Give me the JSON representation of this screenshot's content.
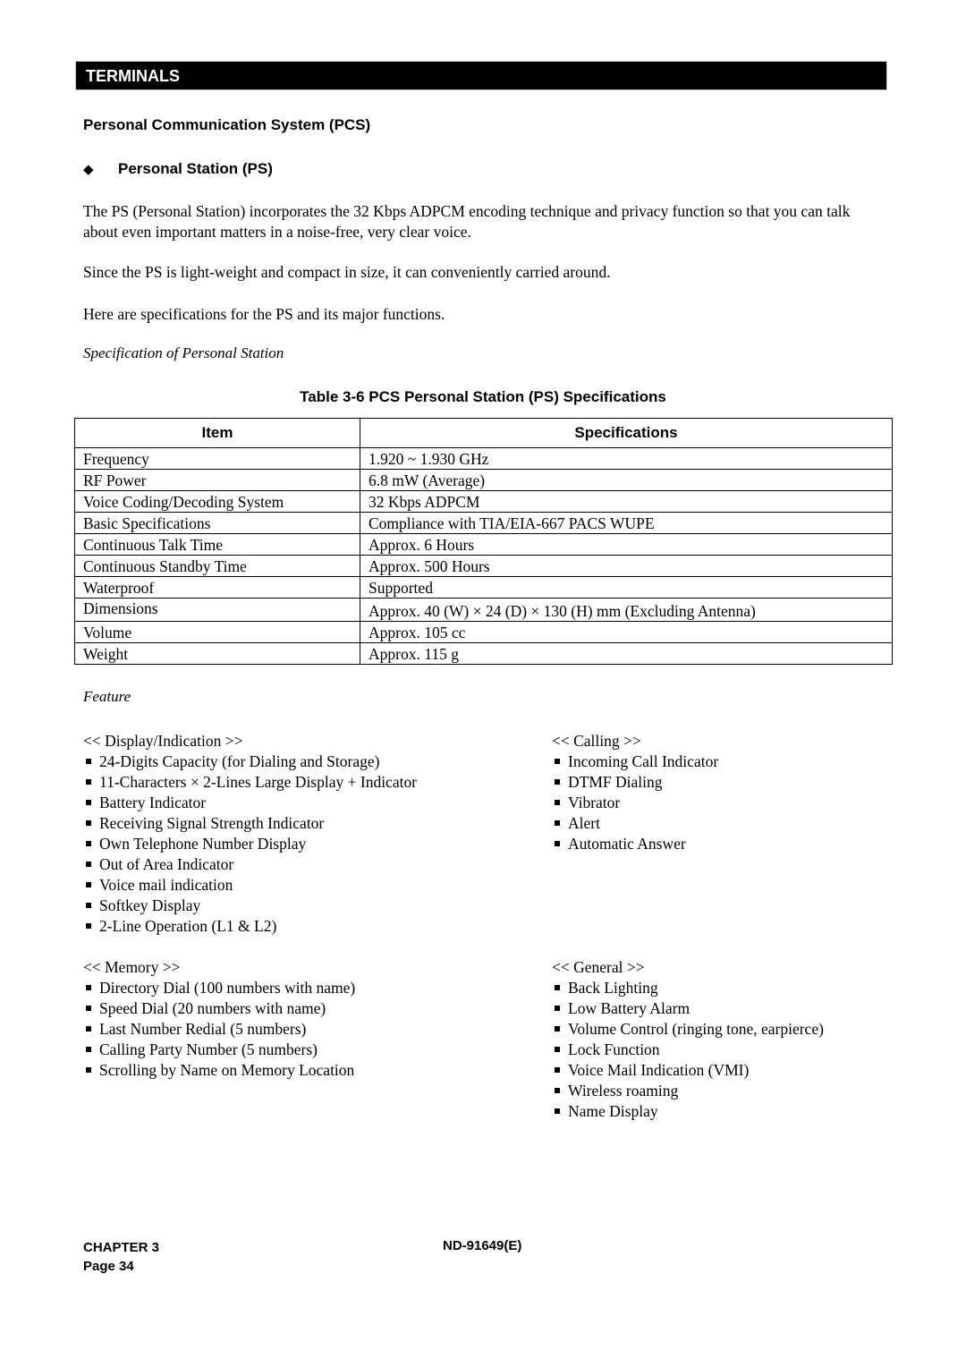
{
  "section_bar": {
    "label": "TERMINALS"
  },
  "heading": "Personal Communication System (PCS)",
  "subheading": {
    "icon": "diamond-bullet-icon",
    "label": "Personal Station (PS)"
  },
  "paragraphs": [
    "The PS (Personal Station) incorporates the 32 Kbps ADPCM encoding technique and privacy function so that you can talk about even important matters in a noise-free, very clear voice.",
    "Since the PS is light-weight and compact in size, it can conveniently carried around.",
    "Here are specifications for the PS and its major functions."
  ],
  "spec_caption": "Specification of Personal Station",
  "table": {
    "title": "Table 3-6  PCS Personal Station (PS) Specifications",
    "headers": [
      "Item",
      "Specifications"
    ],
    "rows": [
      [
        "Frequency",
        "1.920 ~ 1.930 GHz"
      ],
      [
        "RF Power",
        "6.8 mW (Average)"
      ],
      [
        "Voice Coding/Decoding System",
        "32 Kbps ADPCM"
      ],
      [
        "Basic Specifications",
        "Compliance with TIA/EIA-667 PACS WUPE"
      ],
      [
        "Continuous Talk Time",
        "Approx. 6 Hours"
      ],
      [
        "Continuous Standby Time",
        "Approx. 500 Hours"
      ],
      [
        "Waterproof",
        "Supported"
      ],
      [
        "Dimensions",
        "Approx. 40 (W) × 24 (D) × 130 (H) mm (Excluding Antenna)"
      ],
      [
        "Volume",
        "Approx. 105 cc"
      ],
      [
        "Weight",
        "Approx. 115 g"
      ]
    ]
  },
  "feature_caption": "Feature",
  "features": {
    "display": {
      "title": "<< Display/Indication >>",
      "items": [
        "24-Digits Capacity (for Dialing and Storage)",
        "11-Characters × 2-Lines Large Display + Indicator",
        "Battery Indicator",
        "Receiving Signal Strength Indicator",
        "Own Telephone Number Display",
        "Out of Area Indicator",
        "Voice mail indication",
        "Softkey Display",
        "2-Line Operation (L1 & L2)"
      ]
    },
    "calling": {
      "title": "<< Calling >>",
      "items": [
        "Incoming Call Indicator",
        "DTMF Dialing",
        "Vibrator",
        "Alert",
        "Automatic Answer"
      ]
    },
    "memory": {
      "title": "<< Memory >>",
      "items": [
        "Directory Dial (100 numbers with name)",
        "Speed Dial (20 numbers with name)",
        "Last Number Redial (5 numbers)",
        "Calling Party Number (5 numbers)",
        "Scrolling by Name on Memory Location"
      ]
    },
    "general": {
      "title": "<< General >>",
      "items": [
        "Back Lighting",
        "Low Battery Alarm",
        "Volume Control (ringing tone, earpierce)",
        "Lock Function",
        "Voice Mail Indication (VMI)",
        "Wireless roaming",
        "Name Display"
      ]
    }
  },
  "footer": {
    "chapter": "CHAPTER 3",
    "page": "Page 34",
    "doc_id": "ND-91649(E)"
  }
}
